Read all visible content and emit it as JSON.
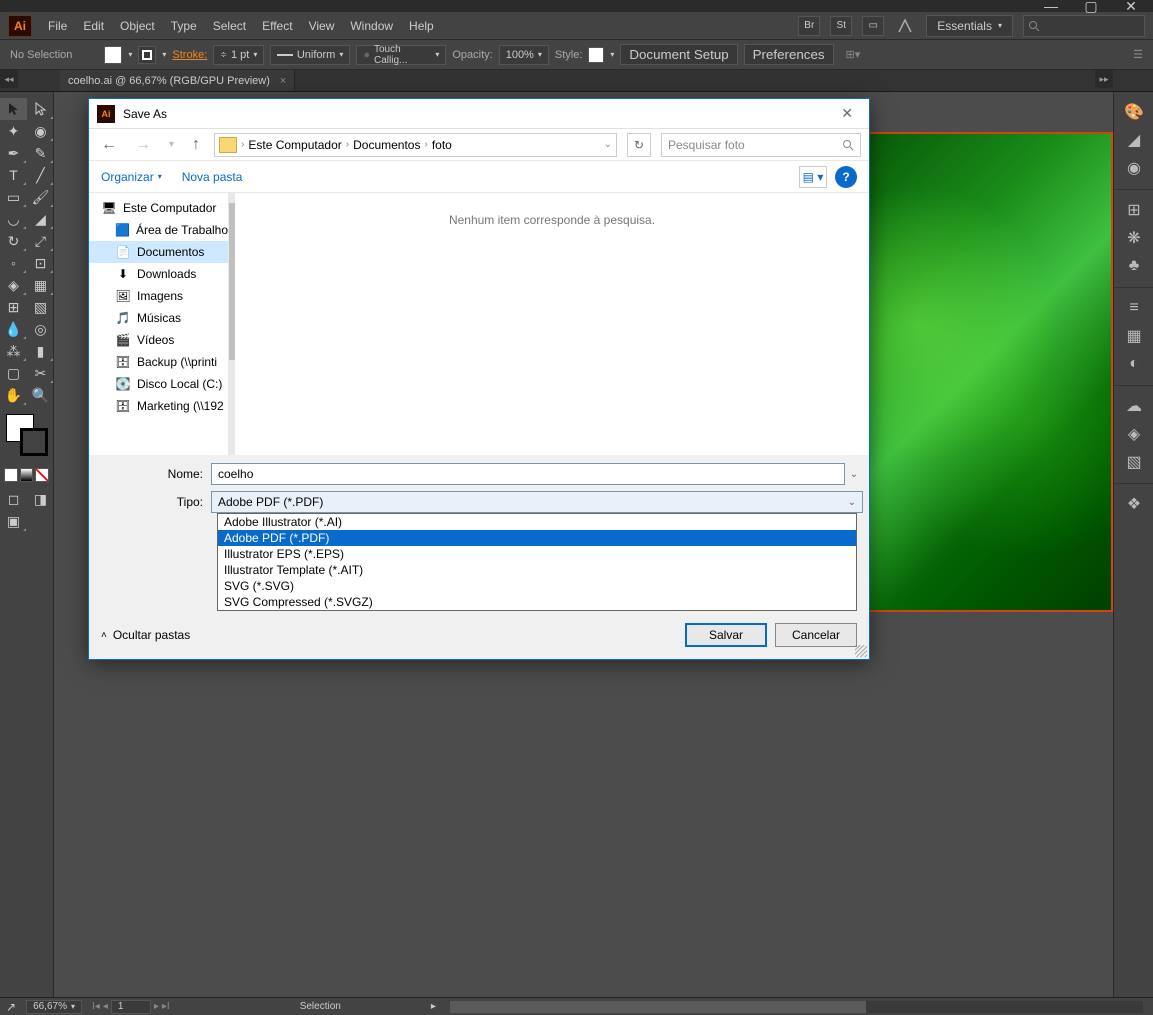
{
  "window": {
    "min": "—",
    "max": "▢",
    "close": "✕"
  },
  "menu": {
    "items": [
      "File",
      "Edit",
      "Object",
      "Type",
      "Select",
      "Effect",
      "View",
      "Window",
      "Help"
    ],
    "workspace": "Essentials"
  },
  "options": {
    "selection": "No Selection",
    "stroke_label": "Stroke:",
    "stroke_val": "1 pt",
    "uniform": "Uniform",
    "brush": "Touch Callig...",
    "opacity_label": "Opacity:",
    "opacity_val": "100%",
    "style_label": "Style:",
    "doc_setup": "Document Setup",
    "prefs": "Preferences"
  },
  "doc_tab": "coelho.ai @ 66,67% (RGB/GPU Preview)",
  "status": {
    "zoom": "66,67%",
    "page": "1",
    "label": "Selection"
  },
  "dialog": {
    "title": "Save As",
    "breadcrumb": [
      "Este Computador",
      "Documentos",
      "foto"
    ],
    "search_placeholder": "Pesquisar foto",
    "organize": "Organizar",
    "new_folder": "Nova pasta",
    "tree": [
      {
        "label": "Este Computador",
        "icon": "pc"
      },
      {
        "label": "Área de Trabalho",
        "icon": "desktop",
        "indent": true
      },
      {
        "label": "Documentos",
        "icon": "doc",
        "indent": true,
        "selected": true
      },
      {
        "label": "Downloads",
        "icon": "down",
        "indent": true
      },
      {
        "label": "Imagens",
        "icon": "img",
        "indent": true
      },
      {
        "label": "Músicas",
        "icon": "music",
        "indent": true
      },
      {
        "label": "Vídeos",
        "icon": "video",
        "indent": true
      },
      {
        "label": "Backup (\\\\printi",
        "icon": "net",
        "indent": true
      },
      {
        "label": "Disco Local (C:)",
        "icon": "drive",
        "indent": true
      },
      {
        "label": "Marketing (\\\\192",
        "icon": "net",
        "indent": true
      }
    ],
    "empty_msg": "Nenhum item corresponde à pesquisa.",
    "name_label": "Nome:",
    "name_value": "coelho",
    "type_label": "Tipo:",
    "type_value": "Adobe PDF (*.PDF)",
    "type_options": [
      "Adobe Illustrator (*.AI)",
      "Adobe PDF (*.PDF)",
      "Illustrator EPS (*.EPS)",
      "Illustrator Template (*.AIT)",
      "SVG (*.SVG)",
      "SVG Compressed (*.SVGZ)"
    ],
    "hide_folders": "Ocultar pastas",
    "save": "Salvar",
    "cancel": "Cancelar"
  }
}
